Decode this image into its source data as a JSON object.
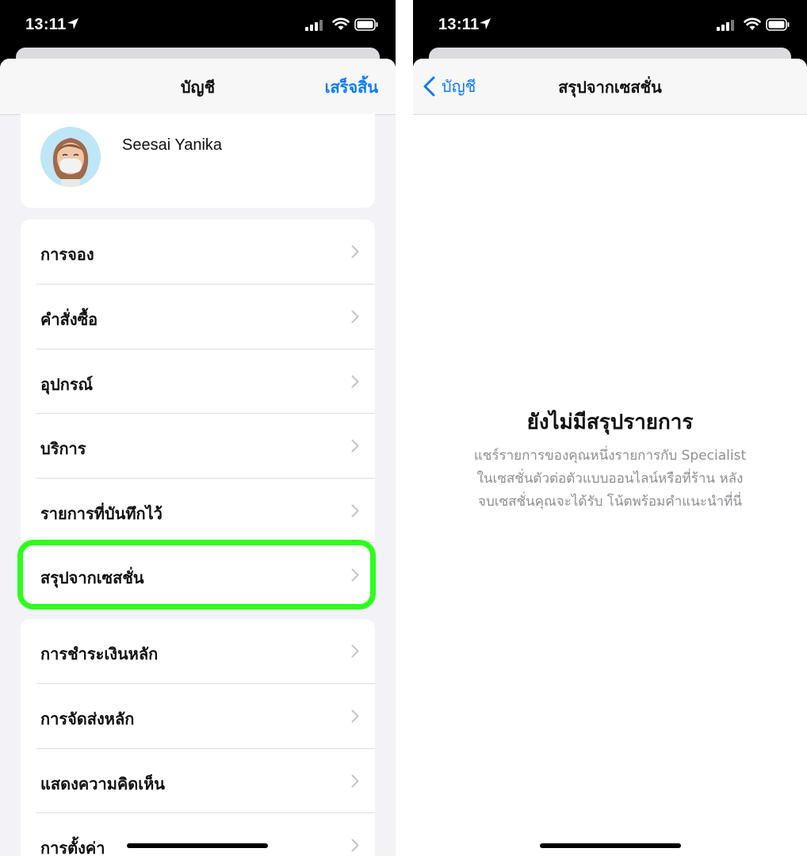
{
  "left": {
    "status": {
      "time": "13:11"
    },
    "nav": {
      "title": "บัญชี",
      "done": "เสร็จสิ้น"
    },
    "profile": {
      "name": "Seesai Yanika"
    },
    "group1": [
      {
        "label": "การจอง"
      },
      {
        "label": "คำสั่งซื้อ"
      },
      {
        "label": "อุปกรณ์"
      },
      {
        "label": "บริการ"
      },
      {
        "label": "รายการที่บันทึกไว้"
      },
      {
        "label": "สรุปจากเซสชั่น"
      }
    ],
    "group2": [
      {
        "label": "การชำระเงินหลัก"
      },
      {
        "label": "การจัดส่งหลัก"
      },
      {
        "label": "แสดงความคิดเห็น"
      },
      {
        "label": "การตั้งค่า"
      }
    ]
  },
  "right": {
    "status": {
      "time": "13:11"
    },
    "nav": {
      "back": "บัญชี",
      "title": "สรุปจากเซสชั่น"
    },
    "empty": {
      "title": "ยังไม่มีสรุปรายการ",
      "line1": "แชร์รายการของคุณหนึ่งรายการกับ Specialist",
      "line2": "ในเซสชั่นตัวต่อตัวแบบออนไลน์หรือที่ร้าน หลัง",
      "line3": "จบเซสชั่นคุณจะได้รับ โน้ตพร้อมคำแนะนำที่นี่"
    }
  },
  "colors": {
    "accent": "#0a7aff",
    "highlight": "#2bff1b",
    "background": "#f2f2f7"
  }
}
